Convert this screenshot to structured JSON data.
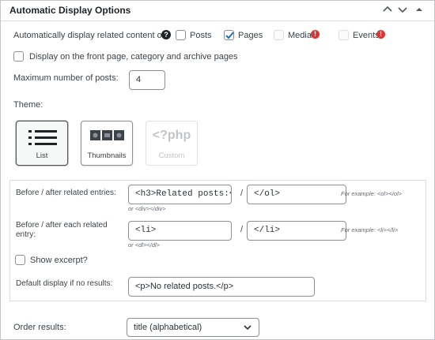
{
  "header": {
    "title": "Automatic Display Options"
  },
  "display_on": {
    "label": "Automatically display related content on:",
    "options": [
      {
        "label": "Posts",
        "checked": false,
        "disabled": false
      },
      {
        "label": "Pages",
        "checked": true,
        "disabled": false
      },
      {
        "label": "Media",
        "checked": false,
        "disabled": true
      },
      {
        "label": "Events",
        "checked": false,
        "disabled": true
      }
    ]
  },
  "archive": {
    "label": "Display on the front page, category and archive pages",
    "checked": false
  },
  "max_posts": {
    "label": "Maximum number of posts:",
    "value": "4"
  },
  "theme": {
    "label": "Theme:",
    "options": [
      {
        "label": "List",
        "selected": true
      },
      {
        "label": "Thumbnails",
        "selected": false
      },
      {
        "label": "Custom",
        "selected": false,
        "disabled": true,
        "glyph": "<?php"
      }
    ]
  },
  "before_after_entries": {
    "label": "Before / after related entries:",
    "before": "<h3>Related posts:<",
    "separator": "/",
    "after": "</ol>",
    "example": "For example: <ol></ol>",
    "example2": "or <div></div>"
  },
  "before_after_each": {
    "label": "Before / after each related entry:",
    "before": "<li>",
    "separator": "/",
    "after": "</li>",
    "example": "For example: <li></li>",
    "example2": "or <dl></dl>"
  },
  "excerpt": {
    "label": "Show excerpt?",
    "checked": false
  },
  "no_results": {
    "label": "Default display if no results:",
    "value": "<p>No related posts.</p>"
  },
  "order": {
    "label": "Order results:",
    "value": "title (alphabetical)"
  },
  "colors": {
    "accent": "#2271b1",
    "alert": "#d63638",
    "border": "#8c8f94"
  }
}
